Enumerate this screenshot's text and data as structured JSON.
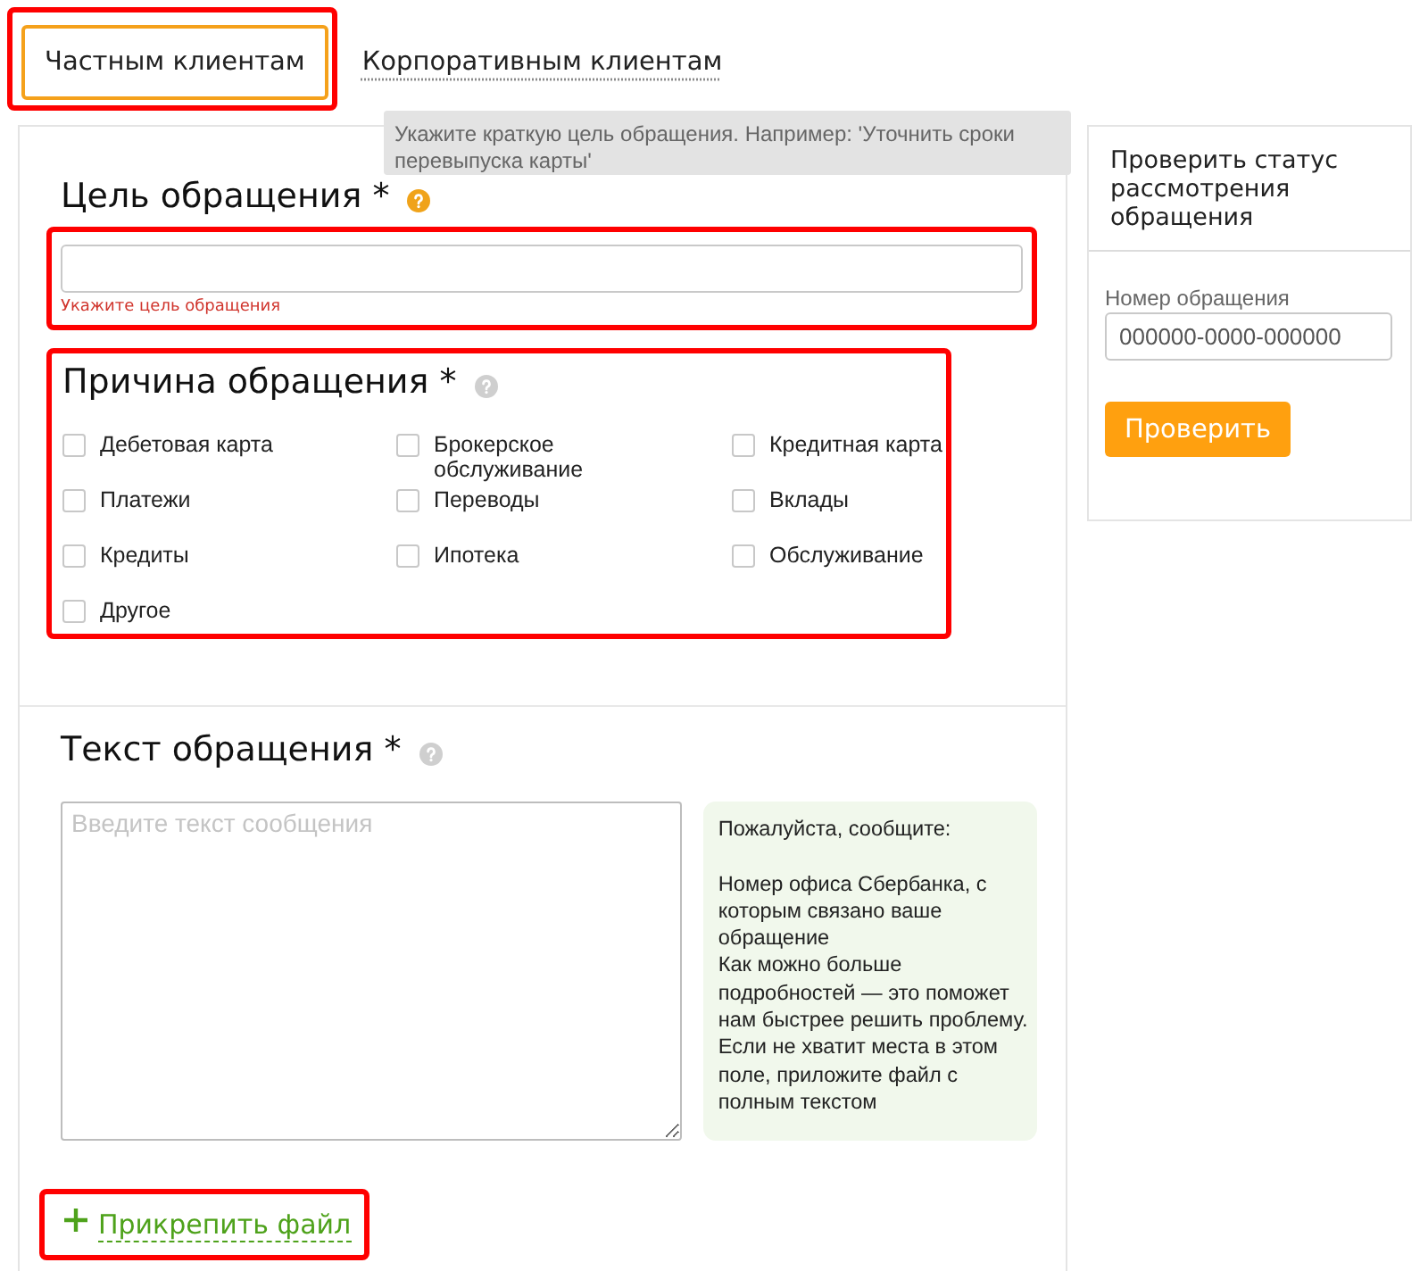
{
  "tabs": [
    {
      "label": "Частным клиентам",
      "selected": true,
      "highlighted": true
    },
    {
      "label": "Корпоративным клиентам",
      "selected": false,
      "highlighted": false
    }
  ],
  "tooltip": {
    "text": "Укажите краткую цель обращения. Например: 'Уточнить сроки перевыпуска карты'"
  },
  "goal": {
    "title": "Цель обращения *",
    "help_active": true,
    "highlighted": true,
    "error": "Укажите цель обращения"
  },
  "reason": {
    "title": "Причина обращения *",
    "help_active": false,
    "highlighted": true,
    "options": [
      {
        "label": "Дебетовая карта",
        "checked": false
      },
      {
        "label": "Брокерское обслуживание",
        "checked": false
      },
      {
        "label": "Кредитная карта",
        "checked": false
      },
      {
        "label": "Платежи",
        "checked": false
      },
      {
        "label": "Переводы",
        "checked": false
      },
      {
        "label": "Вклады",
        "checked": false
      },
      {
        "label": "Кредиты",
        "checked": false
      },
      {
        "label": "Ипотека",
        "checked": false
      },
      {
        "label": "Обслуживание",
        "checked": false
      },
      {
        "label": "Другое",
        "checked": false
      }
    ]
  },
  "message": {
    "title": "Текст обращения *",
    "help_active": false,
    "placeholder": "Введите текст сообщения",
    "hint": {
      "intro": "Пожалуйста, сообщите:",
      "lines": [
        "Номер офиса Сбербанка, с которым связано ваше обращение",
        "Как можно больше подробностей — это поможет нам быстрее решить проблему.",
        "Если не хватит места в этом поле, приложите файл с полным текстом"
      ]
    }
  },
  "attach": {
    "label": "Прикрепить файл",
    "highlighted": true
  },
  "status_panel": {
    "title": "Проверить статус рассмотрения обращения",
    "field_label": "Номер обращения",
    "placeholder": "000000-0000-000000",
    "button": "Проверить"
  }
}
